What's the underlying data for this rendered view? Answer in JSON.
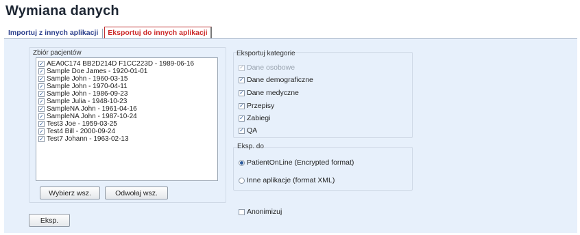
{
  "app": {
    "title": "Wymiana danych"
  },
  "tabs": [
    {
      "label": "Importuj z innych aplikacji",
      "active": false
    },
    {
      "label": "Eksportuj do innych aplikacji",
      "active": true
    }
  ],
  "patients": {
    "label": "Zbiór pacjentów",
    "items": [
      {
        "label": "AEA0C174 BB2D214D F1CC223D - 1989-06-16",
        "checked": true
      },
      {
        "label": "Sample Doe James - 1920-01-01",
        "checked": true
      },
      {
        "label": "Sample John - 1960-03-15",
        "checked": true
      },
      {
        "label": "Sample John - 1970-04-11",
        "checked": true
      },
      {
        "label": "Sample John - 1986-09-23",
        "checked": true
      },
      {
        "label": "Sample Julia - 1948-10-23",
        "checked": true
      },
      {
        "label": "SampleNA John - 1961-04-16",
        "checked": true
      },
      {
        "label": "SampleNA John - 1987-10-24",
        "checked": true
      },
      {
        "label": "Test3 Joe - 1959-03-25",
        "checked": true
      },
      {
        "label": "Test4 Bill - 2000-09-24",
        "checked": true
      },
      {
        "label": "Test7 Johann - 1963-02-13",
        "checked": true
      }
    ],
    "select_all_label": "Wybierz wsz.",
    "deselect_all_label": "Odwołaj wsz."
  },
  "categories": {
    "label": "Eksportuj kategorie",
    "items": [
      {
        "label": "Dane osobowe",
        "checked": true,
        "disabled": true
      },
      {
        "label": "Dane demograficzne",
        "checked": true,
        "disabled": false
      },
      {
        "label": "Dane medyczne",
        "checked": true,
        "disabled": false
      },
      {
        "label": "Przepisy",
        "checked": true,
        "disabled": false
      },
      {
        "label": "Zabiegi",
        "checked": true,
        "disabled": false
      },
      {
        "label": "QA",
        "checked": true,
        "disabled": false
      }
    ]
  },
  "export_to": {
    "label": "Eksp. do",
    "options": [
      {
        "label": "PatientOnLine (Encrypted format)",
        "selected": true
      },
      {
        "label": "Inne aplikacje (format XML)",
        "selected": false
      }
    ]
  },
  "anonymize": {
    "label": "Anonimizuj",
    "checked": false
  },
  "export_button": {
    "label": "Eksp."
  },
  "colors": {
    "panel": "#e7f0fb",
    "accent": "#2a5a9c",
    "active_tab": "#cc2a2a",
    "inactive_tab": "#2b3f8c"
  }
}
